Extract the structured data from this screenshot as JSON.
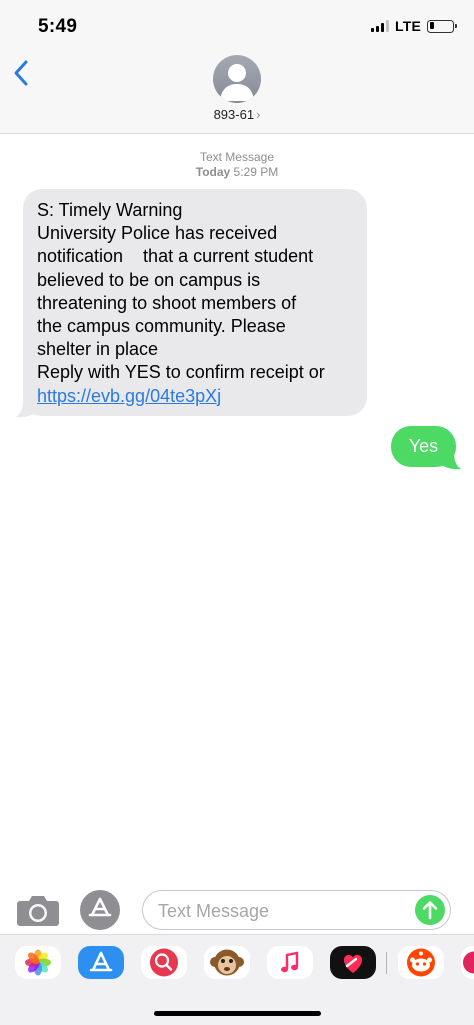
{
  "status_bar": {
    "time": "5:49",
    "network": "LTE"
  },
  "header": {
    "contact": "893-61",
    "back_icon": "chevron-left-icon",
    "avatar_icon": "person-silhouette-icon"
  },
  "conversation": {
    "meta_label": "Text Message",
    "meta_day": "Today",
    "meta_time": "5:29 PM",
    "incoming": {
      "lines": [
        "S: Timely Warning",
        "University Police has received",
        "notification    that a current student",
        "believed to be on campus is",
        "threatening to shoot members of",
        "the campus community. Please",
        "shelter in place",
        "Reply with YES to confirm receipt or"
      ],
      "link": "https://evb.gg/04te3pXj"
    },
    "outgoing": {
      "text": "Yes"
    }
  },
  "input_bar": {
    "placeholder": "Text Message",
    "camera_icon": "camera-icon",
    "apps_icon": "app-store-icon",
    "send_icon": "send-arrow-icon"
  },
  "app_drawer": {
    "apps": [
      "photos-icon",
      "app-store-icon",
      "images-search-icon",
      "animoji-monkey-icon",
      "music-icon",
      "digital-touch-icon",
      "reddit-icon"
    ]
  },
  "colors": {
    "incoming_bubble": "#e9e9eb",
    "outgoing_bubble": "#4cd964",
    "link": "#2a7ae2",
    "accent_blue": "#2a7ae2"
  }
}
